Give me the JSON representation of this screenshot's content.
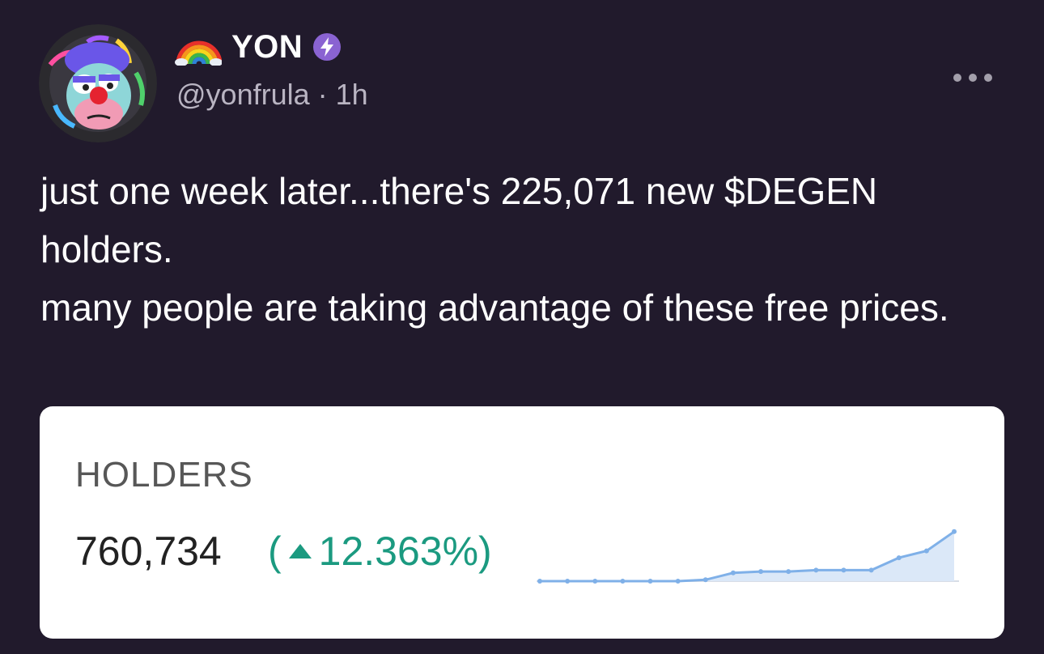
{
  "post": {
    "author": {
      "emoji": "rainbow-icon",
      "display_name": "YON",
      "badge": "power-badge-icon",
      "handle": "@yonfrula",
      "separator": "·",
      "time": "1h"
    },
    "text_lines": [
      "just one week later...there's 225,071 new $DEGEN holders.",
      "many people are taking advantage of these free prices."
    ],
    "embed": {
      "label": "HOLDERS",
      "value": "760,734",
      "change_prefix": "(",
      "change_value": "12.363%)",
      "change_direction": "up",
      "change_color": "#1b9a80"
    }
  },
  "chart_data": {
    "type": "area",
    "series": [
      {
        "values": [
          0,
          0,
          0,
          0,
          0,
          0,
          0.5,
          3,
          3.5,
          3.5,
          4,
          4,
          4,
          8.5,
          11,
          18
        ]
      }
    ],
    "ylim": [
      0,
      20
    ],
    "color": "#7fb0e8"
  },
  "colors": {
    "background": "#211a2c",
    "badge": "#8a63d2",
    "card": "#ffffff"
  }
}
